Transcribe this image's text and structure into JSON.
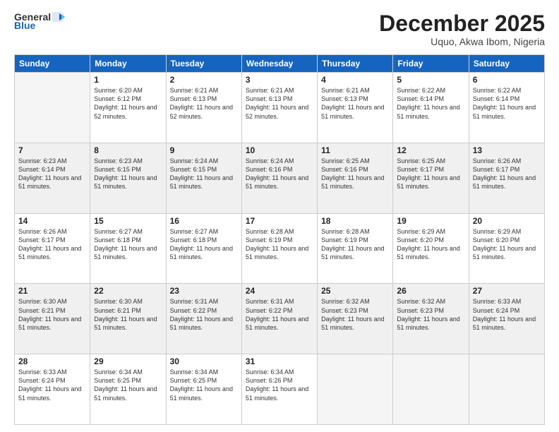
{
  "header": {
    "logo_line1": "General",
    "logo_line2": "Blue",
    "month": "December 2025",
    "location": "Uquo, Akwa Ibom, Nigeria"
  },
  "weekdays": [
    "Sunday",
    "Monday",
    "Tuesday",
    "Wednesday",
    "Thursday",
    "Friday",
    "Saturday"
  ],
  "weeks": [
    [
      {
        "day": "",
        "sunrise": "",
        "sunset": "",
        "daylight": ""
      },
      {
        "day": "1",
        "sunrise": "Sunrise: 6:20 AM",
        "sunset": "Sunset: 6:12 PM",
        "daylight": "Daylight: 11 hours and 52 minutes."
      },
      {
        "day": "2",
        "sunrise": "Sunrise: 6:21 AM",
        "sunset": "Sunset: 6:13 PM",
        "daylight": "Daylight: 11 hours and 52 minutes."
      },
      {
        "day": "3",
        "sunrise": "Sunrise: 6:21 AM",
        "sunset": "Sunset: 6:13 PM",
        "daylight": "Daylight: 11 hours and 52 minutes."
      },
      {
        "day": "4",
        "sunrise": "Sunrise: 6:21 AM",
        "sunset": "Sunset: 6:13 PM",
        "daylight": "Daylight: 11 hours and 51 minutes."
      },
      {
        "day": "5",
        "sunrise": "Sunrise: 6:22 AM",
        "sunset": "Sunset: 6:14 PM",
        "daylight": "Daylight: 11 hours and 51 minutes."
      },
      {
        "day": "6",
        "sunrise": "Sunrise: 6:22 AM",
        "sunset": "Sunset: 6:14 PM",
        "daylight": "Daylight: 11 hours and 51 minutes."
      }
    ],
    [
      {
        "day": "7",
        "sunrise": "Sunrise: 6:23 AM",
        "sunset": "Sunset: 6:14 PM",
        "daylight": "Daylight: 11 hours and 51 minutes."
      },
      {
        "day": "8",
        "sunrise": "Sunrise: 6:23 AM",
        "sunset": "Sunset: 6:15 PM",
        "daylight": "Daylight: 11 hours and 51 minutes."
      },
      {
        "day": "9",
        "sunrise": "Sunrise: 6:24 AM",
        "sunset": "Sunset: 6:15 PM",
        "daylight": "Daylight: 11 hours and 51 minutes."
      },
      {
        "day": "10",
        "sunrise": "Sunrise: 6:24 AM",
        "sunset": "Sunset: 6:16 PM",
        "daylight": "Daylight: 11 hours and 51 minutes."
      },
      {
        "day": "11",
        "sunrise": "Sunrise: 6:25 AM",
        "sunset": "Sunset: 6:16 PM",
        "daylight": "Daylight: 11 hours and 51 minutes."
      },
      {
        "day": "12",
        "sunrise": "Sunrise: 6:25 AM",
        "sunset": "Sunset: 6:17 PM",
        "daylight": "Daylight: 11 hours and 51 minutes."
      },
      {
        "day": "13",
        "sunrise": "Sunrise: 6:26 AM",
        "sunset": "Sunset: 6:17 PM",
        "daylight": "Daylight: 11 hours and 51 minutes."
      }
    ],
    [
      {
        "day": "14",
        "sunrise": "Sunrise: 6:26 AM",
        "sunset": "Sunset: 6:17 PM",
        "daylight": "Daylight: 11 hours and 51 minutes."
      },
      {
        "day": "15",
        "sunrise": "Sunrise: 6:27 AM",
        "sunset": "Sunset: 6:18 PM",
        "daylight": "Daylight: 11 hours and 51 minutes."
      },
      {
        "day": "16",
        "sunrise": "Sunrise: 6:27 AM",
        "sunset": "Sunset: 6:18 PM",
        "daylight": "Daylight: 11 hours and 51 minutes."
      },
      {
        "day": "17",
        "sunrise": "Sunrise: 6:28 AM",
        "sunset": "Sunset: 6:19 PM",
        "daylight": "Daylight: 11 hours and 51 minutes."
      },
      {
        "day": "18",
        "sunrise": "Sunrise: 6:28 AM",
        "sunset": "Sunset: 6:19 PM",
        "daylight": "Daylight: 11 hours and 51 minutes."
      },
      {
        "day": "19",
        "sunrise": "Sunrise: 6:29 AM",
        "sunset": "Sunset: 6:20 PM",
        "daylight": "Daylight: 11 hours and 51 minutes."
      },
      {
        "day": "20",
        "sunrise": "Sunrise: 6:29 AM",
        "sunset": "Sunset: 6:20 PM",
        "daylight": "Daylight: 11 hours and 51 minutes."
      }
    ],
    [
      {
        "day": "21",
        "sunrise": "Sunrise: 6:30 AM",
        "sunset": "Sunset: 6:21 PM",
        "daylight": "Daylight: 11 hours and 51 minutes."
      },
      {
        "day": "22",
        "sunrise": "Sunrise: 6:30 AM",
        "sunset": "Sunset: 6:21 PM",
        "daylight": "Daylight: 11 hours and 51 minutes."
      },
      {
        "day": "23",
        "sunrise": "Sunrise: 6:31 AM",
        "sunset": "Sunset: 6:22 PM",
        "daylight": "Daylight: 11 hours and 51 minutes."
      },
      {
        "day": "24",
        "sunrise": "Sunrise: 6:31 AM",
        "sunset": "Sunset: 6:22 PM",
        "daylight": "Daylight: 11 hours and 51 minutes."
      },
      {
        "day": "25",
        "sunrise": "Sunrise: 6:32 AM",
        "sunset": "Sunset: 6:23 PM",
        "daylight": "Daylight: 11 hours and 51 minutes."
      },
      {
        "day": "26",
        "sunrise": "Sunrise: 6:32 AM",
        "sunset": "Sunset: 6:23 PM",
        "daylight": "Daylight: 11 hours and 51 minutes."
      },
      {
        "day": "27",
        "sunrise": "Sunrise: 6:33 AM",
        "sunset": "Sunset: 6:24 PM",
        "daylight": "Daylight: 11 hours and 51 minutes."
      }
    ],
    [
      {
        "day": "28",
        "sunrise": "Sunrise: 6:33 AM",
        "sunset": "Sunset: 6:24 PM",
        "daylight": "Daylight: 11 hours and 51 minutes."
      },
      {
        "day": "29",
        "sunrise": "Sunrise: 6:34 AM",
        "sunset": "Sunset: 6:25 PM",
        "daylight": "Daylight: 11 hours and 51 minutes."
      },
      {
        "day": "30",
        "sunrise": "Sunrise: 6:34 AM",
        "sunset": "Sunset: 6:25 PM",
        "daylight": "Daylight: 11 hours and 51 minutes."
      },
      {
        "day": "31",
        "sunrise": "Sunrise: 6:34 AM",
        "sunset": "Sunset: 6:26 PM",
        "daylight": "Daylight: 11 hours and 51 minutes."
      },
      {
        "day": "",
        "sunrise": "",
        "sunset": "",
        "daylight": ""
      },
      {
        "day": "",
        "sunrise": "",
        "sunset": "",
        "daylight": ""
      },
      {
        "day": "",
        "sunrise": "",
        "sunset": "",
        "daylight": ""
      }
    ]
  ]
}
